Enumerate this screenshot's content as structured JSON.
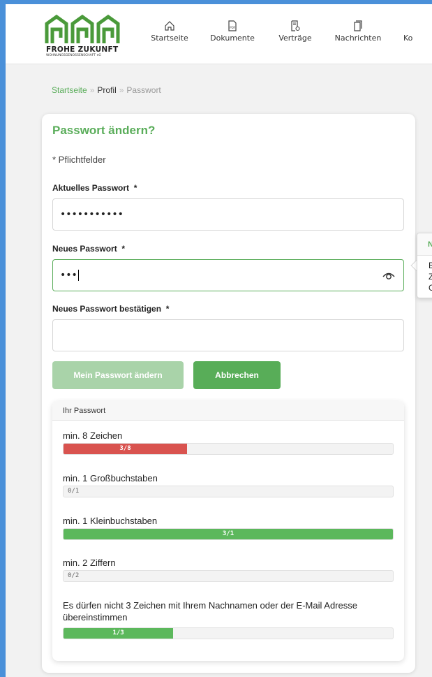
{
  "logo": {
    "text": "FROHE ZUKUNFT",
    "subtext": "WOHNUNGSGENOSSENSCHAFT eG"
  },
  "nav": [
    {
      "label": "Startseite",
      "icon": "house-icon"
    },
    {
      "label": "Dokumente",
      "icon": "pdf-document-icon"
    },
    {
      "label": "Verträge",
      "icon": "contract-icon"
    },
    {
      "label": "Nachrichten",
      "icon": "messages-icon"
    },
    {
      "label": "Ko",
      "icon": "contact-icon"
    }
  ],
  "breadcrumb": {
    "home": "Startseite",
    "profile": "Profil",
    "current": "Passwort",
    "separator": "»"
  },
  "form": {
    "title": "Passwort ändern?",
    "required_note": "* Pflichtfelder",
    "current_password": {
      "label": "Aktuelles Passwort",
      "required": "*",
      "value": "•••••••••••"
    },
    "new_password": {
      "label": "Neues Passwort",
      "required": "*",
      "value": "•••"
    },
    "confirm_password": {
      "label": "Neues Passwort bestätigen",
      "required": "*",
      "value": ""
    }
  },
  "buttons": {
    "change": "Mein Passwort ändern",
    "cancel": "Abbrechen"
  },
  "tooltip": {
    "title": "Ne",
    "lines": [
      "Bi",
      "Ze",
      "Gr"
    ]
  },
  "password_panel": {
    "title": "Ihr Passwort",
    "rules": [
      {
        "label": "min. 8 Zeichen",
        "text": "3/8",
        "fill": 0.375,
        "color": "#d9534f"
      },
      {
        "label": "min. 1 Großbuchstaben",
        "text": "0/1",
        "fill": 0,
        "color": "#5cb85c"
      },
      {
        "label": "min. 1 Kleinbuchstaben",
        "text": "3/1",
        "fill": 1,
        "color": "#5cb85c"
      },
      {
        "label": "min. 2 Ziffern",
        "text": "0/2",
        "fill": 0,
        "color": "#5cb85c"
      },
      {
        "label": "Es dürfen nicht 3 Zeichen mit Ihrem Nachnamen oder der E-Mail Adresse übereinstimmen",
        "text": "1/3",
        "fill": 0.333,
        "color": "#5cb85c"
      }
    ]
  },
  "colors": {
    "accent": "#5aad5a",
    "error": "#d9534f",
    "button_disabled": "#a9d3a9"
  }
}
